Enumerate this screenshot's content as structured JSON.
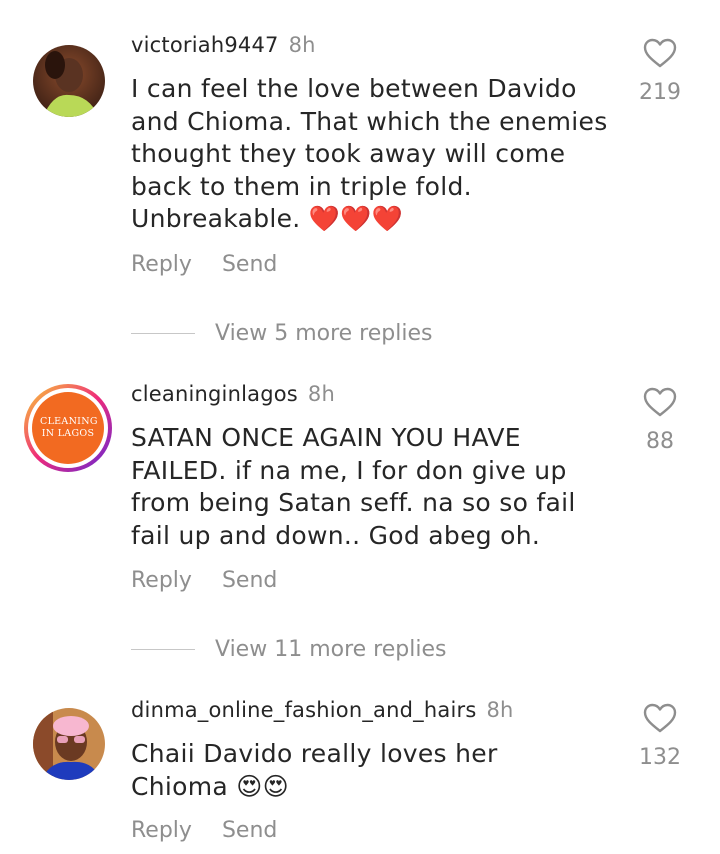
{
  "comments": [
    {
      "username": "victoriah9447",
      "time": "8h",
      "text": "I can feel the love between Davido and Chioma. That which the enemies thought they took away will come back to them in triple fold. Unbreakable. ❤️❤️❤️",
      "reply_label": "Reply",
      "send_label": "Send",
      "like_count": "219",
      "view_replies": "View 5 more replies"
    },
    {
      "username": "cleaninginlagos",
      "time": "8h",
      "text": "SATAN ONCE AGAIN YOU HAVE FAILED. if na me, I for don give up from being Satan seff.  na so so fail fail up and down.. God abeg oh.",
      "reply_label": "Reply",
      "send_label": "Send",
      "like_count": "88",
      "view_replies": "View 11 more replies",
      "avatar_text": "CLEANING IN LAGOS"
    },
    {
      "username": "dinma_online_fashion_and_hairs",
      "time": "8h",
      "text": "Chaii Davido really loves her Chioma 😍😍",
      "reply_label": "Reply",
      "send_label": "Send",
      "like_count": "132"
    }
  ],
  "colors": {
    "text": "#262626",
    "secondary": "#8e8e8e",
    "story_ring_start": "#f58529",
    "story_ring_end": "#dd2a7b",
    "avatar2_bg": "#f26a21"
  },
  "icons": {
    "like": "heart-outline-icon"
  }
}
